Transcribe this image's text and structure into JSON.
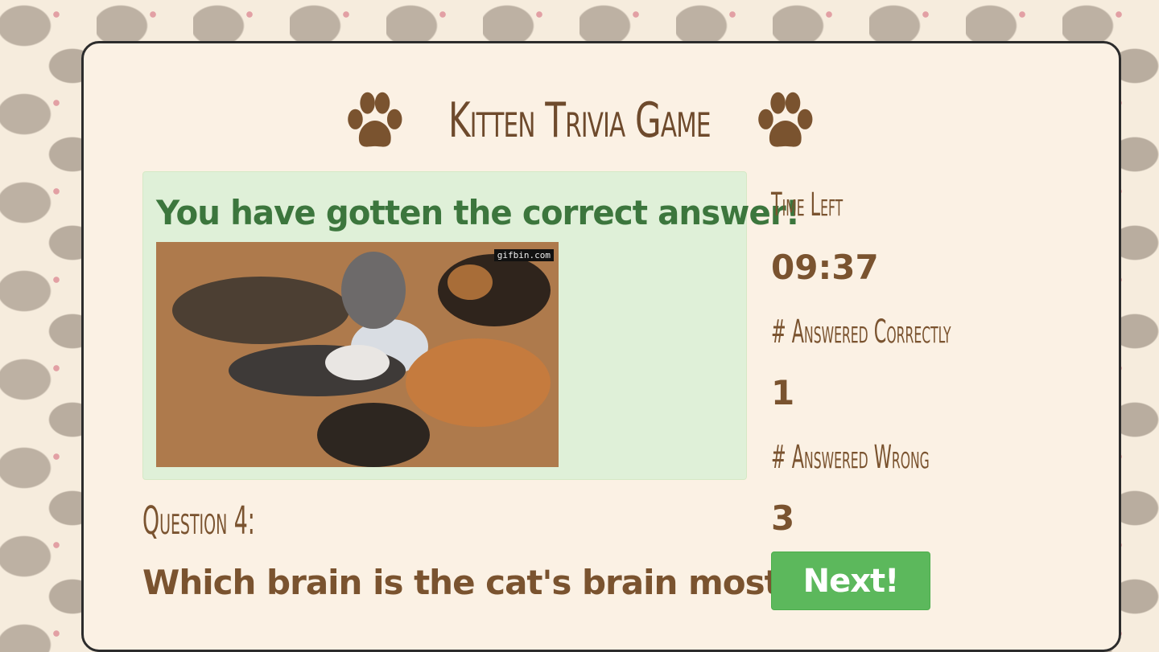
{
  "title": "Kitten Trivia Game",
  "alert": {
    "message": "You have gotten the correct answer!",
    "gif_watermark": "gifbin.com"
  },
  "stats": {
    "time_left_label": "Time Left",
    "time_left_value": "09:37",
    "correct_label": "# Answered Correctly",
    "correct_value": "1",
    "wrong_label": "# Answered Wrong",
    "wrong_value": "3"
  },
  "question": {
    "label": "Question 4:",
    "text": "Which brain is the cat's brain most"
  },
  "next_button": "Next!",
  "colors": {
    "brown": "#6e4a2c",
    "alert_bg": "#dff0d8",
    "alert_text": "#3c763d",
    "button": "#5cb85c"
  }
}
